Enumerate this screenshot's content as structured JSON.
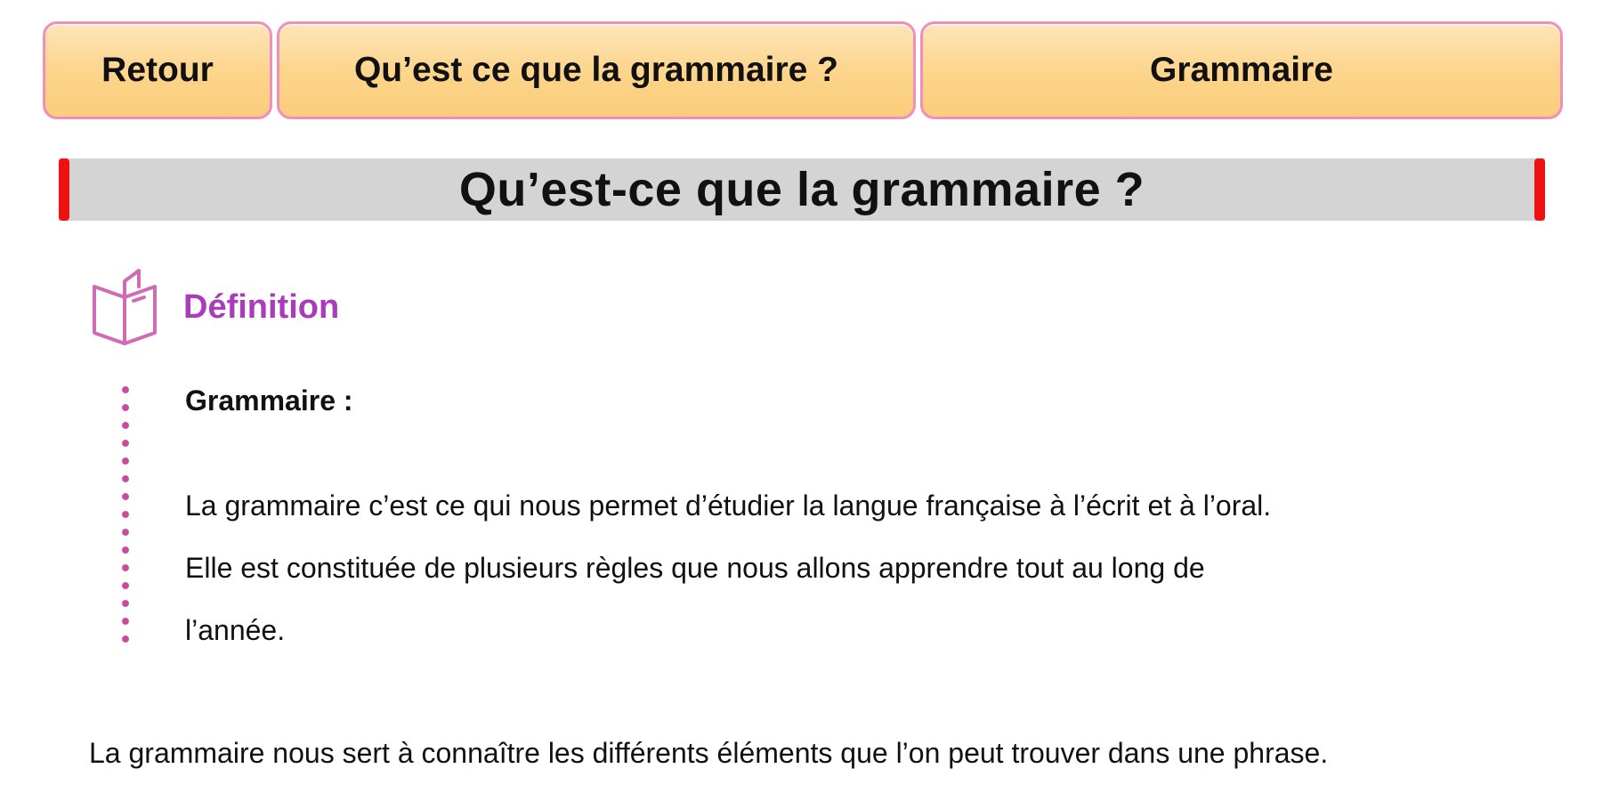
{
  "nav": {
    "back_label": "Retour",
    "lesson_label": "Qu’est ce que la grammaire ?",
    "category_label": "Grammaire"
  },
  "page_title": "Qu’est-ce que la grammaire ?",
  "definition": {
    "icon": "open-book-icon",
    "heading": "Définition",
    "term": "Grammaire :",
    "lines": [
      "La grammaire c’est ce qui nous permet d’étudier la langue française à l’écrit et à l’oral.",
      "Elle est constituée de plusieurs règles que nous allons apprendre tout au long de",
      "l’année."
    ]
  },
  "body_text": "La grammaire nous sert à connaître les différents éléments que l’on peut trouver dans une phrase.",
  "colors": {
    "nav_border": "#ef8fbb",
    "nav_fill": "#fdd48a",
    "title_bar": "#d4d4d4",
    "title_edge": "#ee1111",
    "accent": "#a93cb8",
    "dots": "#c84b9e"
  }
}
